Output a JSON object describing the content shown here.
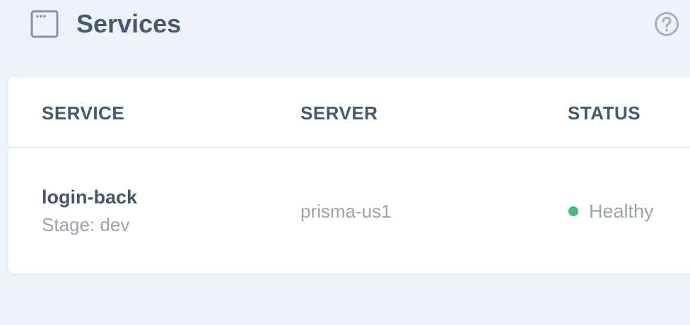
{
  "header": {
    "title": "Services",
    "icon": "browser-window-icon",
    "help_icon": "help-circle-icon"
  },
  "table": {
    "columns": [
      "SERVICE",
      "SERVER",
      "STATUS"
    ],
    "rows": [
      {
        "service_name": "login-back",
        "stage": "Stage: dev",
        "server": "prisma-us1",
        "status": "Healthy",
        "status_color": "#48bb78"
      }
    ]
  },
  "colors": {
    "background": "#eef2f6",
    "card": "#ffffff",
    "heading": "#465a6e",
    "muted": "#9aa4af",
    "healthy": "#48bb78"
  }
}
